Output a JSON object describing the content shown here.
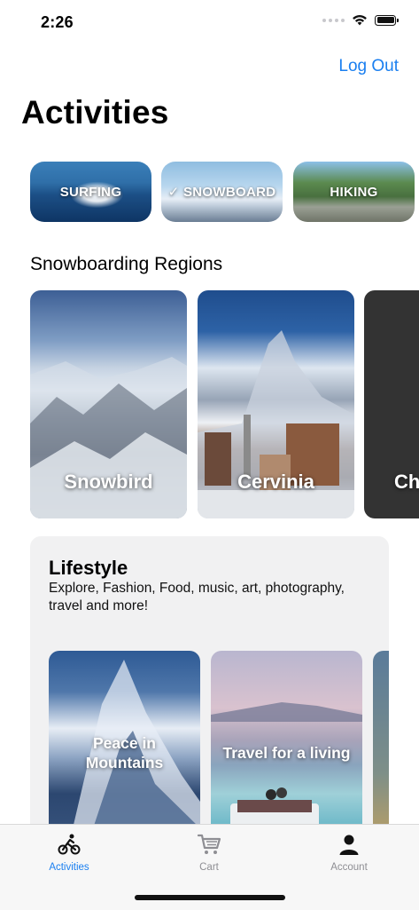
{
  "status_bar": {
    "time": "2:26"
  },
  "header": {
    "logout_label": "Log Out",
    "title": "Activities"
  },
  "activities": [
    {
      "label": "SURFING",
      "selected": false
    },
    {
      "label": "✓ SNOWBOARD",
      "selected": true
    },
    {
      "label": "HIKING",
      "selected": false
    }
  ],
  "regions": {
    "heading": "Snowboarding Regions",
    "items": [
      {
        "name": "Snowbird"
      },
      {
        "name": "Cervinia"
      },
      {
        "name": "Ch"
      }
    ]
  },
  "lifestyle": {
    "title": "Lifestyle",
    "description": "Explore, Fashion, Food, music, art, photography, travel and more!",
    "cards": [
      {
        "title": "Peace in Mountains"
      },
      {
        "title": "Travel for a living"
      }
    ]
  },
  "tabbar": {
    "items": [
      {
        "label": "Activities",
        "icon": "cyclist-icon",
        "active": true
      },
      {
        "label": "Cart",
        "icon": "cart-icon",
        "active": false
      },
      {
        "label": "Account",
        "icon": "person-icon",
        "active": false
      }
    ],
    "active_color": "#1a7ff0",
    "inactive_color": "#8e8e93"
  },
  "colors": {
    "accent": "#1a7ff0",
    "panel": "#f1f1f2",
    "dark_card": "#333333"
  }
}
